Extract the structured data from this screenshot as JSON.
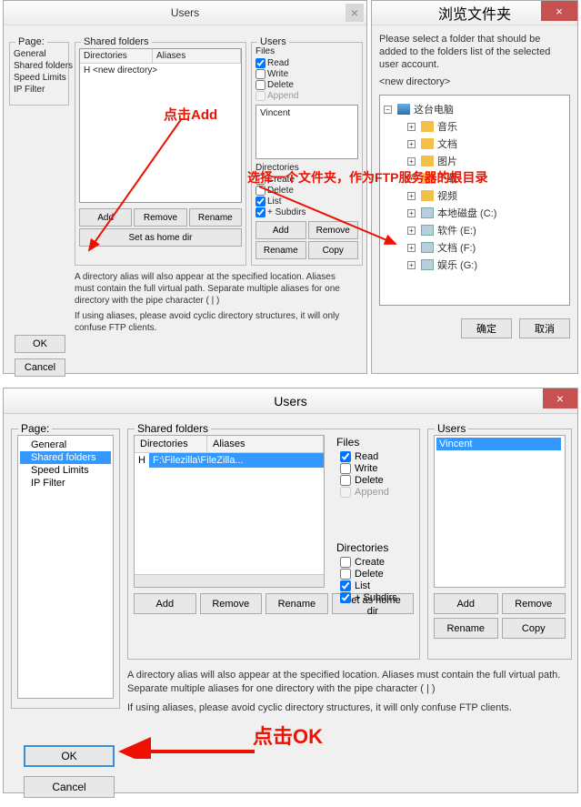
{
  "top": {
    "users_dialog": {
      "title": "Users",
      "close": "×",
      "page_label": "Page:",
      "pages": [
        "General",
        "Shared folders",
        "Speed Limits",
        "IP Filter"
      ],
      "shared_label": "Shared folders",
      "dir_col": "Directories",
      "alias_col": "Aliases",
      "dir_row": "H <new directory>",
      "add": "Add",
      "remove": "Remove",
      "rename": "Rename",
      "sethome": "Set as home dir",
      "users_label": "Users",
      "files_label": "Files",
      "chk_read": "Read",
      "chk_write": "Write",
      "chk_delete": "Delete",
      "chk_append": "Append",
      "dirs_label": "Directories",
      "chk_create": "Create",
      "chk_list": "List",
      "chk_subdirs": "+ Subdirs",
      "user_add": "Add",
      "user_remove": "Remove",
      "user_rename": "Rename",
      "user_copy": "Copy",
      "user_vincent": "Vincent",
      "help1": "A directory alias will also appear at the specified location. Aliases must contain the full virtual path. Separate multiple aliases for one directory with the pipe character ( | )",
      "help2": "If using aliases, please avoid cyclic directory structures, it will only confuse FTP clients.",
      "ok": "OK",
      "cancel": "Cancel"
    },
    "browse_dialog": {
      "title": "浏览文件夹",
      "close": "×",
      "instr": "Please select a folder that should be added to the folders list of the selected user account.",
      "newdir": "<new directory>",
      "tree": {
        "root": "这台电脑",
        "items": [
          "音乐",
          "文档",
          "图片",
          "下载",
          "视频",
          "本地磁盘 (C:)",
          "软件 (E:)",
          "文档 (F:)",
          "娱乐 (G:)"
        ]
      },
      "ok": "确定",
      "cancel": "取消"
    },
    "anno_add": "点击Add",
    "anno_root": "选择一个文件夹，作为FTP服务器的根目录"
  },
  "bottom": {
    "title": "Users",
    "close": "×",
    "page_label": "Page:",
    "pages": [
      "General",
      "Shared folders",
      "Speed Limits",
      "IP Filter"
    ],
    "page_sel_index": 1,
    "shared_label": "Shared folders",
    "dir_col": "Directories",
    "alias_col": "Aliases",
    "dir_h": "H",
    "dir_path": "F:\\Filezilla\\FileZilla...",
    "add": "Add",
    "remove": "Remove",
    "rename": "Rename",
    "sethome": "Set as home dir",
    "files_label": "Files",
    "read": "Read",
    "write": "Write",
    "delete": "Delete",
    "append": "Append",
    "dirs_label": "Directories",
    "create": "Create",
    "list": "List",
    "subdirs": "+ Subdirs",
    "users_label": "Users",
    "user": "Vincent",
    "uadd": "Add",
    "uremove": "Remove",
    "urename": "Rename",
    "ucopy": "Copy",
    "help1": "A directory alias will also appear at the specified location. Aliases must contain the full virtual path. Separate multiple aliases for one directory with the pipe character ( | )",
    "help2": "If using aliases, please avoid cyclic directory structures, it will only confuse FTP clients.",
    "ok": "OK",
    "cancel": "Cancel",
    "anno_ok": "点击OK"
  }
}
